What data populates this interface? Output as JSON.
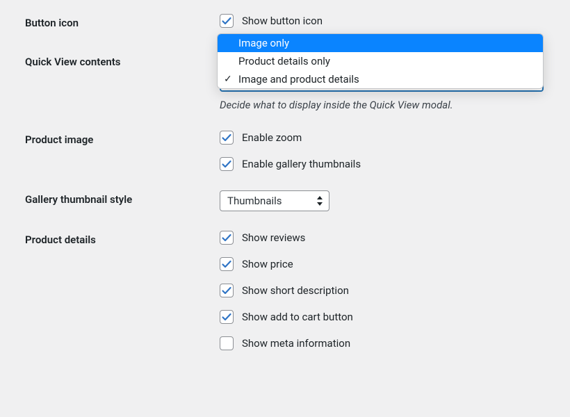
{
  "rows": {
    "button_icon": {
      "label": "Button icon",
      "checkbox": {
        "checked": true,
        "label": "Show button icon"
      }
    },
    "quick_view": {
      "label": "Quick View contents",
      "helper": "Decide what to display inside the Quick View modal.",
      "options": [
        {
          "label": "Image only",
          "highlighted": true,
          "selected": false
        },
        {
          "label": "Product details only",
          "highlighted": false,
          "selected": false
        },
        {
          "label": "Image and product details",
          "highlighted": false,
          "selected": true
        }
      ]
    },
    "product_image": {
      "label": "Product image",
      "checks": [
        {
          "checked": true,
          "label": "Enable zoom"
        },
        {
          "checked": true,
          "label": "Enable gallery thumbnails"
        }
      ]
    },
    "gallery_style": {
      "label": "Gallery thumbnail style",
      "value": "Thumbnails"
    },
    "product_details": {
      "label": "Product details",
      "checks": [
        {
          "checked": true,
          "label": "Show reviews"
        },
        {
          "checked": true,
          "label": "Show price"
        },
        {
          "checked": true,
          "label": "Show short description"
        },
        {
          "checked": true,
          "label": "Show add to cart button"
        },
        {
          "checked": false,
          "label": "Show meta information"
        }
      ]
    }
  }
}
